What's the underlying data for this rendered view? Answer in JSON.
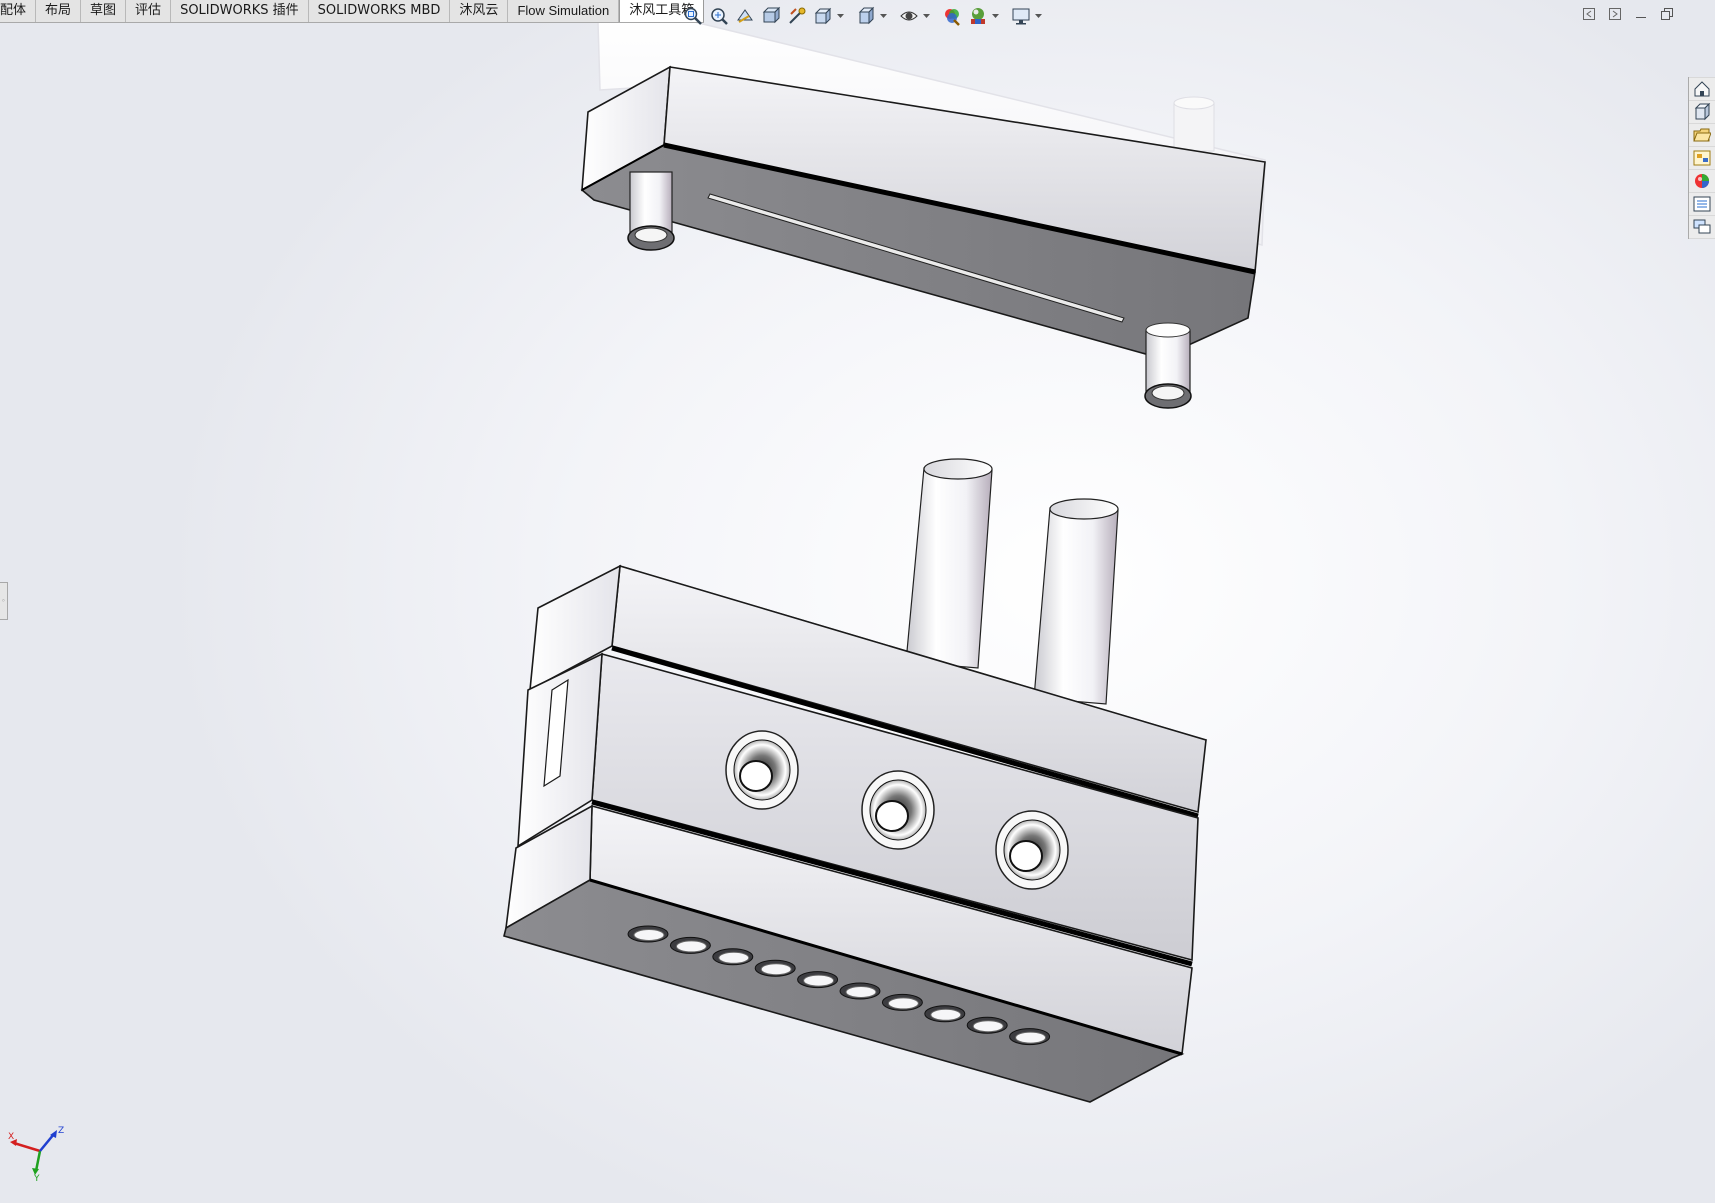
{
  "tabs": [
    {
      "label": "装配体",
      "display": "配体"
    },
    {
      "label": "布局"
    },
    {
      "label": "草图"
    },
    {
      "label": "评估"
    },
    {
      "label": "SOLIDWORKS 插件"
    },
    {
      "label": "SOLIDWORKS MBD"
    },
    {
      "label": "沐风云"
    },
    {
      "label": "Flow Simulation"
    },
    {
      "label": "沐风工具箱",
      "active": true
    }
  ],
  "view_toolbar": {
    "buttons": [
      "zoom-to-fit-icon",
      "zoom-to-area-icon",
      "previous-view-icon",
      "section-view-icon",
      "dynamic-annotation-icon",
      "view-orientation-icon",
      "display-style-icon",
      "hide-show-items-icon",
      "edit-appearance-icon",
      "apply-scene-icon",
      "view-settings-icon"
    ]
  },
  "window_controls": [
    "tile-left-icon",
    "tile-right-icon",
    "minimize-icon",
    "restore-icon"
  ],
  "task_pane": [
    "solidworks-resources-icon",
    "design-library-icon",
    "file-explorer-icon",
    "view-palette-icon",
    "appearances-icon",
    "custom-properties-icon",
    "forum-icon"
  ],
  "triad": {
    "x_label": "X",
    "y_label": "Y",
    "z_label": "Z"
  },
  "colors": {
    "tab_bar": "#e4e4e4",
    "active_tab": "#ffffff",
    "x_axis": "#d42020",
    "y_axis": "#1fa11f",
    "z_axis": "#2040d0",
    "part_light": "#eaeaef",
    "part_mid": "#d6d6dc",
    "part_dark": "#7e7e83"
  }
}
